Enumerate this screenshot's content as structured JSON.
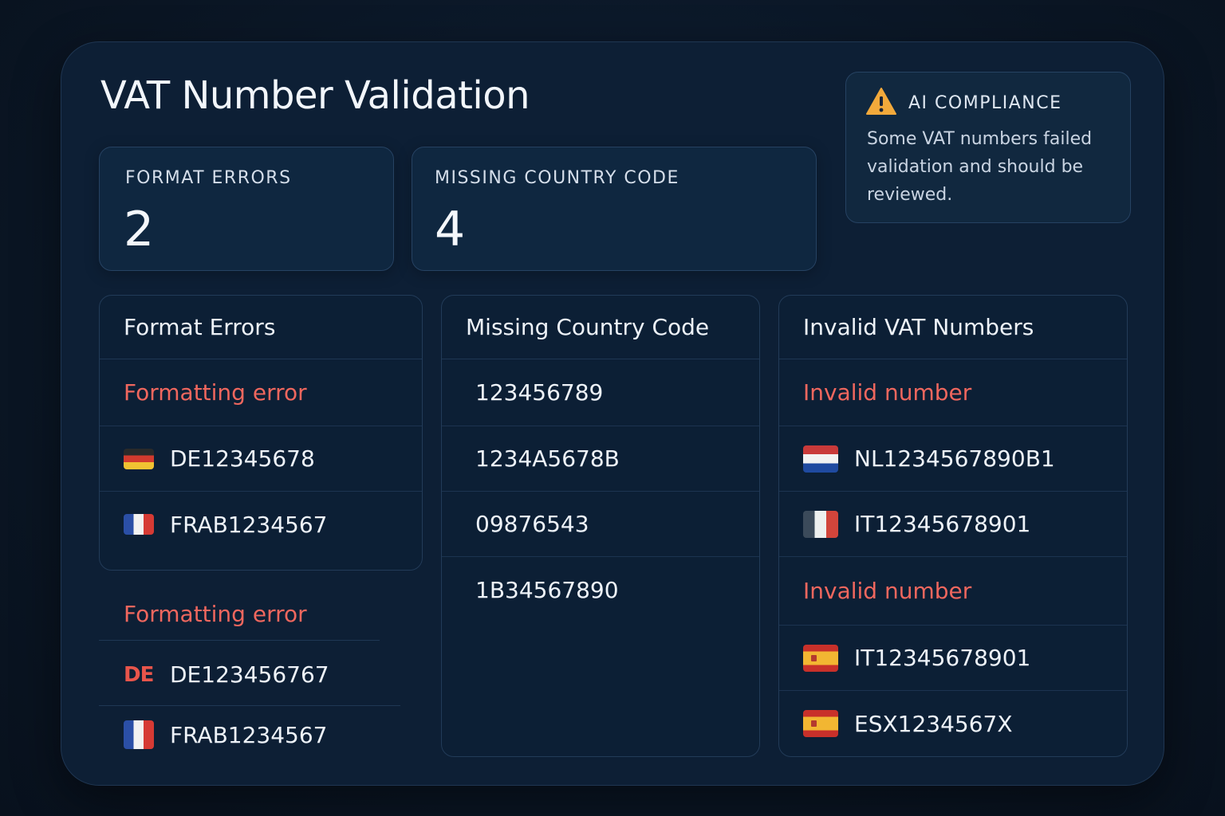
{
  "page": {
    "title": "VAT Number Validation"
  },
  "stats": [
    {
      "label": "FORMAT ERRORS",
      "value": "2"
    },
    {
      "label": "MISSING COUNTRY CODE",
      "value": "4"
    }
  ],
  "alert": {
    "icon": "warning-icon",
    "title": "AI COMPLIANCE",
    "body": "Some VAT numbers failed validation and should be reviewed.",
    "accent": "#f2a93b"
  },
  "format_errors": {
    "heading": "Format Errors",
    "group_label": "Formatting error",
    "items": [
      {
        "flag": "flag-germany-icon",
        "value": "DE12345678"
      },
      {
        "flag": "flag-france-icon",
        "value": "FRAB1234567"
      }
    ]
  },
  "format_errors_extra": {
    "group_label": "Formatting error",
    "items": [
      {
        "flag": "de-text-icon",
        "badge": "DE",
        "value": "DE123456767"
      },
      {
        "flag": "flag-france-icon",
        "value": "FRAB1234567"
      }
    ]
  },
  "missing_country_code": {
    "heading": "Missing Country Code",
    "items": [
      "123456789",
      "1234A5678B",
      "09876543",
      "1B34567890"
    ]
  },
  "invalid_vat": {
    "heading": "Invalid VAT Numbers",
    "groups": [
      {
        "label": "Invalid number",
        "items": [
          {
            "flag": "flag-netherlands-icon",
            "value": "NL1234567890B1"
          },
          {
            "flag": "flag-italy-icon",
            "value": "IT12345678901"
          }
        ]
      },
      {
        "label": "Invalid number",
        "items": [
          {
            "flag": "flag-spain-icon",
            "value": "IT12345678901"
          },
          {
            "flag": "flag-spain-icon",
            "value": "ESX1234567X"
          }
        ]
      }
    ]
  },
  "colors": {
    "error": "#f0675e",
    "background": "#0d1f35"
  }
}
